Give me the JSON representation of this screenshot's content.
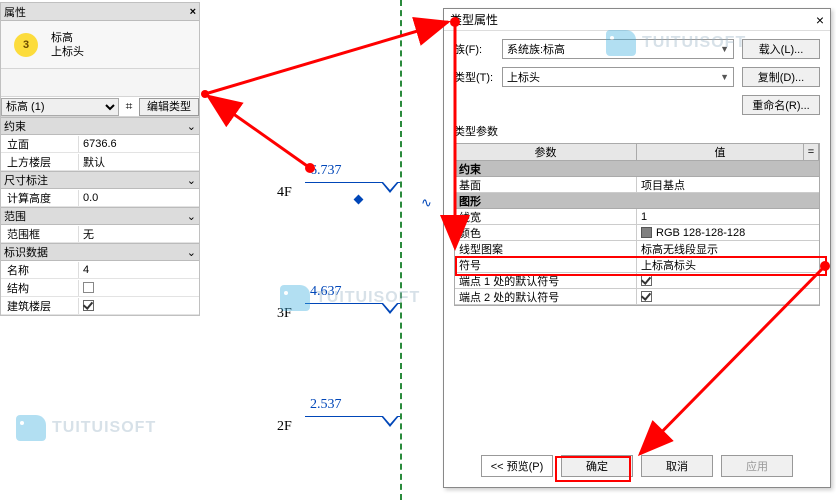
{
  "panel": {
    "title": "属性",
    "thumb_badge": "3",
    "thumb_line1": "标高",
    "thumb_line2": "上标头",
    "filter_selected": "标高 (1)",
    "edit_type_btn": "编辑类型",
    "sections": {
      "constraint": "约束",
      "dimension": "尺寸标注",
      "extent": "范围",
      "identity": "标识数据"
    },
    "rows": {
      "elevation_k": "立面",
      "elevation_v": "6736.6",
      "upper_k": "上方楼层",
      "upper_v": "默认",
      "calcht_k": "计算高度",
      "calcht_v": "0.0",
      "scope_k": "范围框",
      "scope_v": "无",
      "name_k": "名称",
      "name_v": "4",
      "struct_k": "结构",
      "bldg_k": "建筑楼层"
    }
  },
  "canvas": {
    "f4_label": "4F",
    "f4_val": "6.737",
    "f3_label": "3F",
    "f3_val": "4.637",
    "f2_label": "2F",
    "f2_val": "2.537"
  },
  "dialog": {
    "title": "类型属性",
    "family_label": "族(F):",
    "family_value": "系统族:标高",
    "type_label": "类型(T):",
    "type_value": "上标头",
    "btn_load": "载入(L)...",
    "btn_copy": "复制(D)...",
    "btn_rename": "重命名(R)...",
    "type_params_label": "类型参数",
    "grid_header_param": "参数",
    "grid_header_value": "值",
    "sec_constraint": "约束",
    "row_base_k": "基面",
    "row_base_v": "项目基点",
    "sec_graphic": "图形",
    "row_lw_k": "线宽",
    "row_lw_v": "1",
    "row_color_k": "颜色",
    "row_color_v": "RGB 128-128-128",
    "row_pattern_k": "线型图案",
    "row_pattern_v": "标高无线段显示",
    "row_symbol_k": "符号",
    "row_symbol_v": "上标高标头",
    "row_end1_k": "端点 1 处的默认符号",
    "row_end2_k": "端点 2 处的默认符号",
    "btn_preview": "<< 预览(P)",
    "btn_ok": "确定",
    "btn_cancel": "取消",
    "btn_apply": "应用"
  },
  "watermark": "TUITUISOFT",
  "chart_data": {
    "type": "table",
    "title": "类型属性 — 类型参数",
    "columns": [
      "参数",
      "值"
    ],
    "rows": [
      [
        "基面",
        "项目基点"
      ],
      [
        "线宽",
        "1"
      ],
      [
        "颜色",
        "RGB 128-128-128"
      ],
      [
        "线型图案",
        "标高无线段显示"
      ],
      [
        "符号",
        "上标高标头"
      ],
      [
        "端点 1 处的默认符号",
        true
      ],
      [
        "端点 2 处的默认符号",
        true
      ]
    ]
  }
}
